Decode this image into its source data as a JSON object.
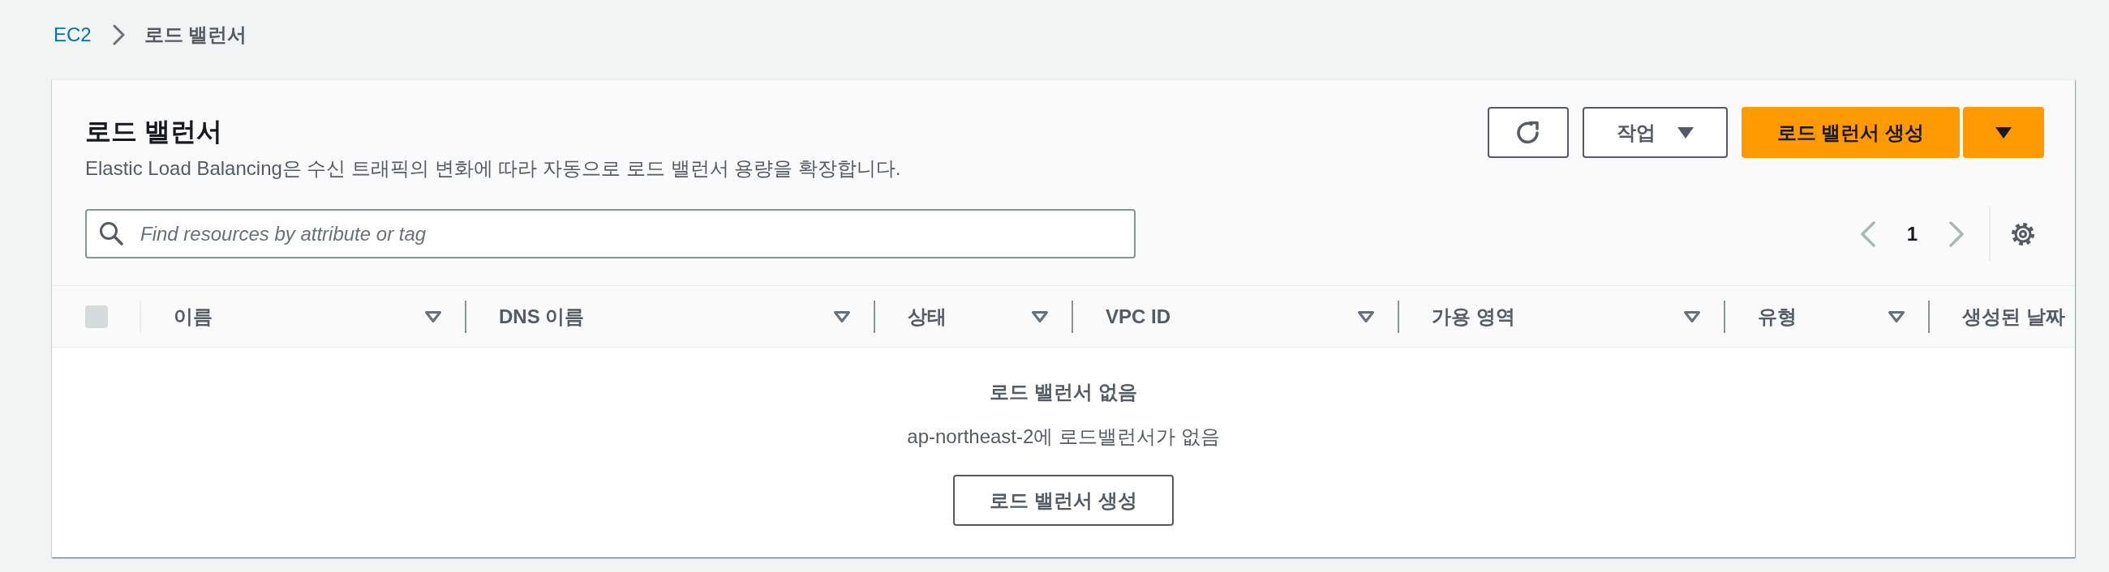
{
  "breadcrumb": [
    {
      "label": "EC2",
      "kind": "link"
    },
    {
      "label": "로드 밸런서",
      "kind": "current"
    }
  ],
  "header": {
    "title": "로드 밸런서",
    "description": "Elastic Load Balancing은 수신 트래픽의 변화에 따라 자동으로 로드 밸런서 용량을 확장합니다.",
    "actions_button": "작업",
    "create_button": "로드 밸런서 생성"
  },
  "search": {
    "placeholder": "Find resources by attribute or tag"
  },
  "pagination": {
    "page": "1",
    "previous": {
      "disabled": true
    },
    "next": {
      "disabled": true
    }
  },
  "table": {
    "select_all": {
      "checked": false,
      "disabled": true
    },
    "columns": [
      {
        "label": "이름",
        "sortable": true
      },
      {
        "label": "DNS 이름",
        "sortable": true
      },
      {
        "label": "상태",
        "sortable": true
      },
      {
        "label": "VPC ID",
        "sortable": true
      },
      {
        "label": "가용 영역",
        "sortable": true
      },
      {
        "label": "유형",
        "sortable": true
      },
      {
        "label": "생성된 날짜",
        "sortable": false
      }
    ],
    "empty_state": {
      "title": "로드 밸런서 없음",
      "message": "ap-northeast-2에 로드밸런서가 없음",
      "button": "로드 밸런서 생성"
    }
  }
}
